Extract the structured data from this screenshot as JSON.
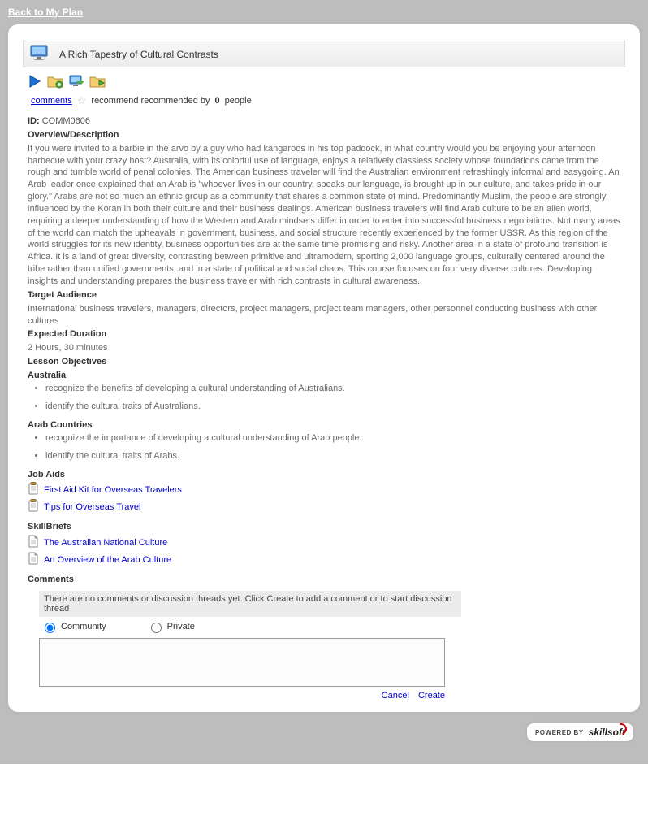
{
  "nav": {
    "back_link": "Back to My Plan"
  },
  "header": {
    "title": "A Rich Tapestry of Cultural Contrasts"
  },
  "subbar": {
    "comments_link": "comments",
    "recommend_text": "recommend recommended by",
    "recommend_count": "0",
    "recommend_suffix": "people"
  },
  "course": {
    "id_label": "ID:",
    "id_value": "COMM0606",
    "overview_head": "Overview/Description",
    "overview_body": "If you were invited to a barbie in the arvo by a guy who had kangaroos in his top paddock, in what country would you be enjoying your afternoon barbecue with your crazy host? Australia, with its colorful use of language, enjoys a relatively classless society whose foundations came from the rough and tumble world of penal colonies. The American business traveler will find the Australian environment refreshingly informal and easygoing. An Arab leader once explained that an Arab is \"whoever lives in our country, speaks our language, is brought up in our culture, and takes pride in our glory.\" Arabs are not so much an ethnic group as a community that shares a common state of mind. Predominantly Muslim, the people are strongly influenced by the Koran in both their culture and their business dealings. American business travelers will find Arab culture to be an alien world, requiring a deeper understanding of how the Western and Arab mindsets differ in order to enter into successful business negotiations. Not many areas of the world can match the upheavals in government, business, and social structure recently experienced by the former USSR. As this region of the world struggles for its new identity, business opportunities are at the same time promising and risky. Another area in a state of profound transition is Africa. It is a land of great diversity, contrasting between primitive and ultramodern, sporting 2,000 language groups, culturally centered around the tribe rather than unified governments, and in a state of political and social chaos. This course focuses on four very diverse cultures. Developing insights and understanding prepares the business traveler with rich contrasts in cultural awareness.",
    "target_head": "Target Audience",
    "target_body": "International business travelers, managers, directors, project managers, project team managers, other personnel conducting business with other cultures",
    "duration_head": "Expected Duration",
    "duration_body": "2 Hours, 30 minutes",
    "objectives_head": "Lesson Objectives",
    "obj_groups": [
      {
        "title": "Australia",
        "items": [
          "recognize the benefits of developing a cultural understanding of Australians.",
          "identify the cultural traits of Australians."
        ]
      },
      {
        "title": "Arab Countries",
        "items": [
          "recognize the importance of developing a cultural understanding of Arab people.",
          "identify the cultural traits of Arabs."
        ]
      }
    ],
    "jobaids_head": "Job Aids",
    "jobaids": [
      "First Aid Kit for Overseas Travelers",
      "Tips for Overseas Travel"
    ],
    "skillbriefs_head": "SkillBriefs",
    "skillbriefs": [
      "The Australian National Culture",
      "An Overview of the Arab Culture"
    ],
    "comments_head": "Comments"
  },
  "comments": {
    "empty_hint": "There are no comments or discussion threads yet. Click Create to add a comment or to start discussion thread",
    "radio_community": "Community",
    "radio_private": "Private",
    "cancel": "Cancel",
    "create": "Create"
  },
  "footer": {
    "powered_by": "POWERED BY",
    "brand": "skillsoft"
  }
}
